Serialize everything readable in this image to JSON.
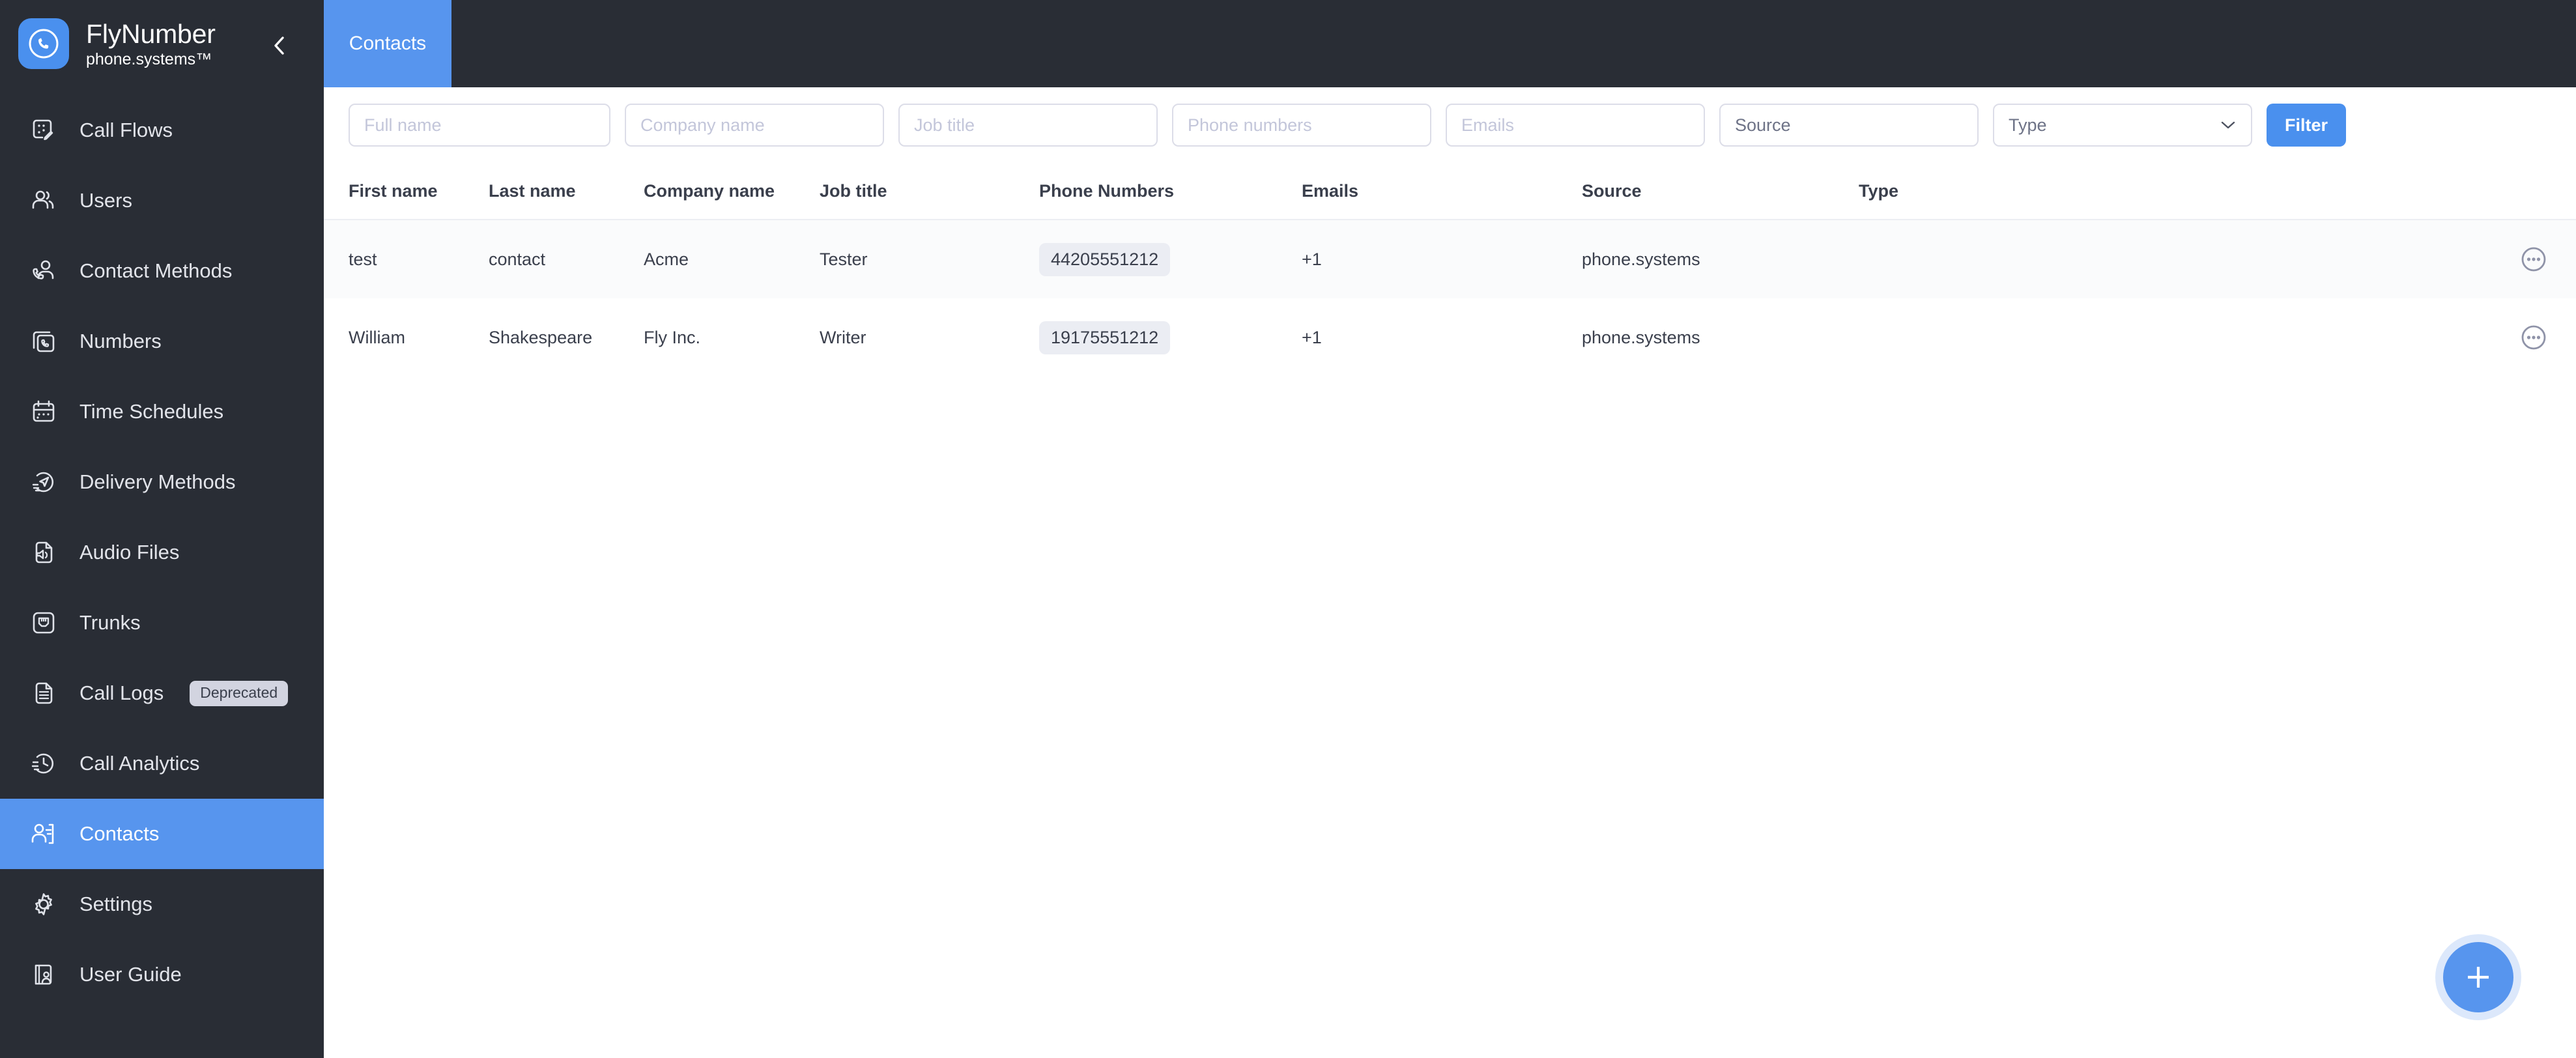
{
  "brand": {
    "logo_icon": "phone-in-circle-icon",
    "title": "FlyNumber",
    "subtitle": "phone.systems™",
    "collapse_icon": "chevron-left-icon"
  },
  "sidebar": {
    "items": [
      {
        "label": "Call Flows",
        "icon": "call-flow-icon",
        "active": false,
        "badge": null
      },
      {
        "label": "Users",
        "icon": "users-icon",
        "active": false,
        "badge": null
      },
      {
        "label": "Contact Methods",
        "icon": "contact-methods-icon",
        "active": false,
        "badge": null
      },
      {
        "label": "Numbers",
        "icon": "numbers-icon",
        "active": false,
        "badge": null
      },
      {
        "label": "Time Schedules",
        "icon": "calendar-icon",
        "active": false,
        "badge": null
      },
      {
        "label": "Delivery Methods",
        "icon": "delivery-icon",
        "active": false,
        "badge": null
      },
      {
        "label": "Audio Files",
        "icon": "audio-file-icon",
        "active": false,
        "badge": null
      },
      {
        "label": "Trunks",
        "icon": "trunk-icon",
        "active": false,
        "badge": null
      },
      {
        "label": "Call Logs",
        "icon": "document-icon",
        "active": false,
        "badge": "Deprecated"
      },
      {
        "label": "Call Analytics",
        "icon": "clock-analytics-icon",
        "active": false,
        "badge": null
      },
      {
        "label": "Contacts",
        "icon": "contacts-icon",
        "active": true,
        "badge": null
      },
      {
        "label": "Settings",
        "icon": "gear-icon",
        "active": false,
        "badge": null
      },
      {
        "label": "User Guide",
        "icon": "user-guide-icon",
        "active": false,
        "badge": null
      }
    ]
  },
  "topbar": {
    "tabs": [
      {
        "label": "Contacts",
        "active": true
      }
    ]
  },
  "filters": {
    "full_name": {
      "placeholder": "Full name",
      "value": ""
    },
    "company_name": {
      "placeholder": "Company name",
      "value": ""
    },
    "job_title": {
      "placeholder": "Job title",
      "value": ""
    },
    "phone_numbers": {
      "placeholder": "Phone numbers",
      "value": ""
    },
    "emails": {
      "placeholder": "Emails",
      "value": ""
    },
    "source": {
      "label": "Source",
      "icon": "chevron-down-icon"
    },
    "type": {
      "label": "Type",
      "icon": "chevron-down-icon"
    },
    "filter_button": "Filter"
  },
  "table": {
    "columns": [
      "First name",
      "Last name",
      "Company name",
      "Job title",
      "Phone Numbers",
      "Emails",
      "Source",
      "Type"
    ],
    "rows": [
      {
        "first_name": "test",
        "last_name": "contact",
        "company_name": "Acme",
        "job_title": "Tester",
        "phone_number": "44205551212",
        "email": "+1",
        "source": "phone.systems",
        "type": "",
        "actions_icon": "more-options-icon"
      },
      {
        "first_name": "William",
        "last_name": "Shakespeare",
        "company_name": "Fly Inc.",
        "job_title": "Writer",
        "phone_number": "19175551212",
        "email": "+1",
        "source": "phone.systems",
        "type": "",
        "actions_icon": "more-options-icon"
      }
    ]
  },
  "fab": {
    "icon": "plus-icon",
    "label": ""
  },
  "colors": {
    "sidebar_bg": "#292d35",
    "accent_blue": "#5795ee",
    "button_blue": "#4a90ee",
    "badge_bg": "#d2d4e0",
    "chip_bg": "#ebedf3",
    "row_alt_bg": "#fafbfc",
    "text_dark": "#3a3f4c",
    "placeholder": "#c3c6da"
  }
}
